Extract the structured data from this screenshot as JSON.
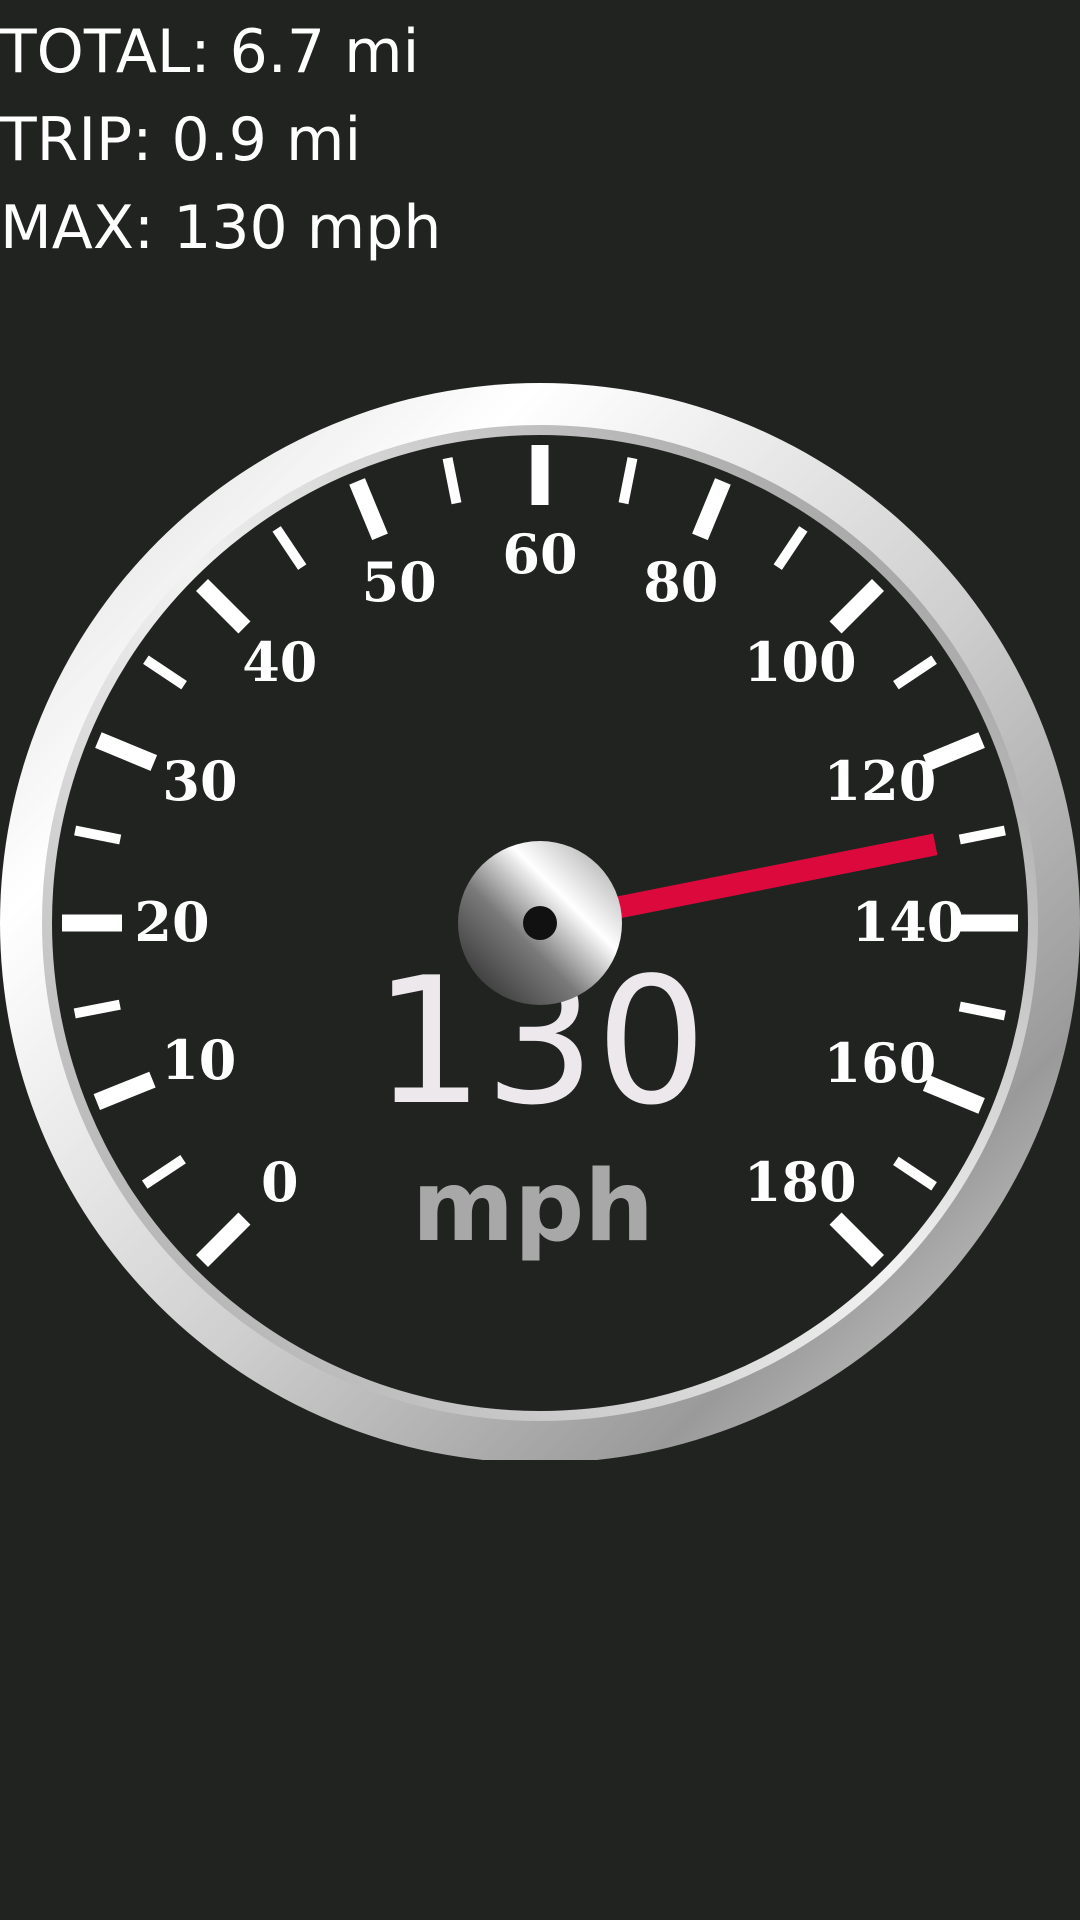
{
  "stats": {
    "total": "TOTAL: 6.7 mi",
    "trip": "TRIP: 0.9 mi",
    "max": "MAX: 130 mph"
  },
  "speedometer": {
    "speed": 130,
    "speed_text": "130",
    "unit": "mph",
    "tick_labels": [
      {
        "value": 0,
        "text": "0"
      },
      {
        "value": 10,
        "text": "10"
      },
      {
        "value": 20,
        "text": "20"
      },
      {
        "value": 30,
        "text": "30"
      },
      {
        "value": 40,
        "text": "40"
      },
      {
        "value": 50,
        "text": "50"
      },
      {
        "value": 60,
        "text": "60"
      },
      {
        "value": 80,
        "text": "80"
      },
      {
        "value": 100,
        "text": "100"
      },
      {
        "value": 120,
        "text": "120"
      },
      {
        "value": 140,
        "text": "140"
      },
      {
        "value": 160,
        "text": "160"
      },
      {
        "value": 180,
        "text": "180"
      }
    ],
    "needle_color": "#dc0a3c",
    "dial_color": "#212321"
  }
}
